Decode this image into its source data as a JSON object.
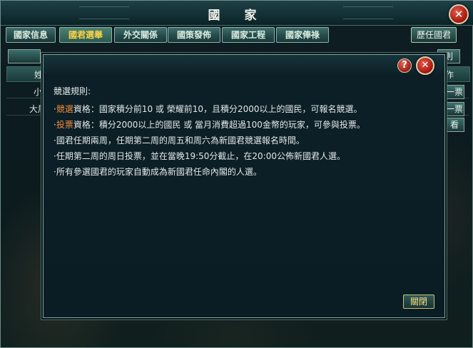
{
  "window": {
    "title": "國 家",
    "history_button": "歷任國君"
  },
  "tabs": [
    {
      "label": "國家信息",
      "active": false
    },
    {
      "label": "國君選舉",
      "active": true
    },
    {
      "label": "外交關係",
      "active": false
    },
    {
      "label": "國策發佈",
      "active": false
    },
    {
      "label": "國家工程",
      "active": false
    },
    {
      "label": "國家俸祿",
      "active": false
    }
  ],
  "background_fragments": {
    "header_left": "姓",
    "header_right": "作",
    "row1_left": "小",
    "row2_left": "大周",
    "rule_button_fragment": "則",
    "vote_button_1": "一票",
    "vote_button_2": "一票",
    "side_button_fragment": "看"
  },
  "dialog": {
    "rules_title": "競選規則:",
    "rules": [
      {
        "bullet": "·",
        "keyword": "競選",
        "text": "資格：國家積分前10 或 榮耀前10，且積分2000以上的國民，可報名競選。"
      },
      {
        "bullet": "·",
        "keyword": "投票",
        "text": "資格：積分2000以上的國民 或 當月消費超過100金幣的玩家，可參與投票。"
      },
      {
        "bullet": "·",
        "keyword": "",
        "text": "國君任期兩周，任期第二周的周五和周六為新國君競選報名時間。"
      },
      {
        "bullet": "·",
        "keyword": "",
        "text": "任期第二周的周日投票，並在當晚19:50分截止，在20:00公佈新國君人選。"
      },
      {
        "bullet": "·",
        "keyword": "",
        "text": "所有參選國君的玩家自動成為新國君任命內閣的人選。"
      }
    ],
    "close_button": "關閉",
    "help_icon_glyph": "?",
    "close_icon_glyph": "✕"
  },
  "colors": {
    "keyword": "#f08a3c",
    "active_tab_text": "#ffd44a",
    "close_red": "#c0281a"
  }
}
